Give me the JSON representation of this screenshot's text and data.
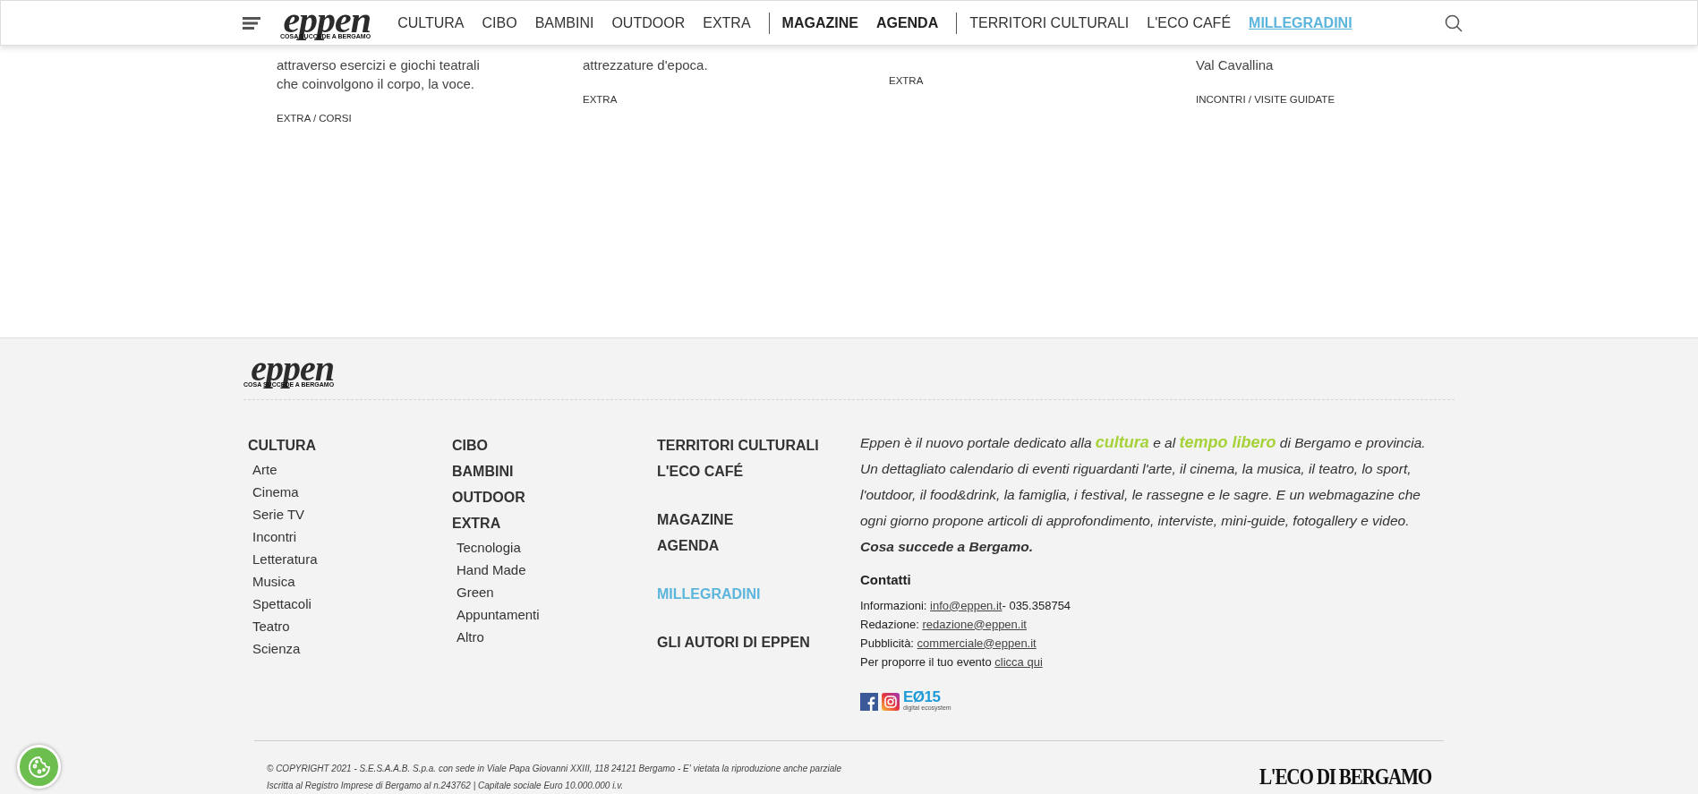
{
  "header": {
    "logo": {
      "name": "eppen",
      "tagline": "COSA SUCCEDE A BERGAMO"
    },
    "nav_groups": [
      [
        {
          "kind": "regular",
          "label": "CULTURA"
        },
        {
          "kind": "regular",
          "label": "CIBO"
        },
        {
          "kind": "regular",
          "label": "BAMBINI"
        },
        {
          "kind": "regular",
          "label": "OUTDOOR"
        },
        {
          "kind": "regular",
          "label": "EXTRA"
        }
      ],
      [
        {
          "kind": "bold",
          "label": "MAGAZINE"
        },
        {
          "kind": "bold",
          "label": "AGENDA"
        }
      ],
      [
        {
          "kind": "regular",
          "label": "TERRITORI CULTURALI"
        },
        {
          "kind": "regular",
          "label": "L'ECO CAFÉ"
        },
        {
          "kind": "highlight",
          "label": "MILLEGRADINI"
        }
      ]
    ]
  },
  "cards": [
    {
      "lines": [
        "attraverso esercizi e giochi teatrali",
        "che coinvolgono il corpo, la voce."
      ],
      "tags": "EXTRA / CORSI"
    },
    {
      "lines": [
        "attrezzature d'epoca."
      ],
      "tags": "EXTRA"
    },
    {
      "tags": "EXTRA"
    },
    {
      "lines": [
        "Val Cavallina"
      ],
      "tags": "INCONTRI / VISITE GUIDATE"
    }
  ],
  "footer": {
    "logo": {
      "name": "eppen",
      "tagline": "COSA SUCCEDE A BERGAMO"
    },
    "columns": [
      [
        [
          {
            "label": "CULTURA",
            "kind": "link",
            "children": [
              "Arte",
              "Cinema",
              "Serie TV",
              "Incontri",
              "Letteratura",
              "Musica",
              "Spettacoli",
              "Teatro",
              "Scienza"
            ]
          }
        ]
      ],
      [
        [
          {
            "label": "CIBO",
            "kind": "link"
          },
          {
            "label": "BAMBINI",
            "kind": "link"
          },
          {
            "label": "OUTDOOR",
            "kind": "link"
          },
          {
            "label": "EXTRA",
            "kind": "link",
            "children": [
              "Tecnologia",
              "Hand Made",
              "Green",
              "Appuntamenti",
              "Altro"
            ]
          }
        ]
      ],
      [
        [
          {
            "label": "TERRITORI CULTURALI",
            "kind": "link"
          },
          {
            "label": "L'ECO CAFÉ",
            "kind": "link"
          }
        ],
        [
          {
            "label": "MAGAZINE",
            "kind": "link"
          },
          {
            "label": "AGENDA",
            "kind": "link"
          }
        ],
        [
          {
            "label": "MILLEGRADINI",
            "kind": "highlight"
          }
        ],
        [
          {
            "label": "GLI AUTORI DI EPPEN",
            "kind": "link"
          }
        ]
      ]
    ],
    "about": [
      {
        "kind": "plain",
        "text": "Eppen è il nuovo portale dedicato alla "
      },
      {
        "kind": "accent",
        "text": "cultura"
      },
      {
        "kind": "plain",
        "text": " e al "
      },
      {
        "kind": "accent",
        "text": "tempo libero"
      },
      {
        "kind": "plain",
        "text": " di Bergamo e provincia. Un dettagliato calendario di eventi riguardanti l'arte, il cinema, la musica, il teatro, lo sport, l'outdoor, il food&drink, la famiglia, i festival, le rassegne e le sagre. E un webmagazine che ogni giorno propone articoli di approfondimento, interviste, mini-guide, fotogallery e video. "
      },
      {
        "kind": "strong",
        "text": "Cosa succede a Bergamo."
      }
    ],
    "contacts_title": "Contatti",
    "contacts": [
      {
        "label": "Informazioni: ",
        "link": "info@eppen.it",
        "suffix": "- 035.358754"
      },
      {
        "label": "Redazione: ",
        "link": "redazione@eppen.it"
      },
      {
        "label": "Pubblicità: ",
        "link": "commerciale@eppen.it"
      },
      {
        "label": "Per proporre il tuo evento ",
        "link": "clicca qui"
      }
    ],
    "social": [
      {
        "kind": "facebook"
      },
      {
        "kind": "instagram"
      },
      {
        "kind": "e015",
        "label": "EØ15",
        "caption": "digital ecosystem"
      }
    ],
    "copyright": [
      "© COPYRIGHT 2021 - S.E.S.A.A.B. S.p.a. con sede in Viale Papa Giovanni XXIII, 118 24121 Bergamo - E' vietata la riproduzione anche parziale",
      "Iscritta al Registro Imprese di Bergamo al n.243762 | Capitale sociale Euro 10.000.000 i.v."
    ],
    "publisher_logo": "L'ECO DI BERGAMO"
  }
}
